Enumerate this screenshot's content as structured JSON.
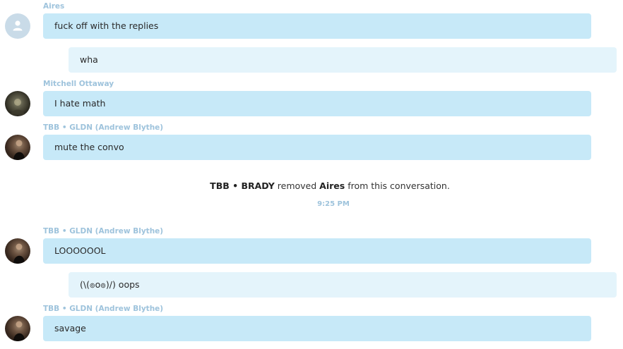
{
  "messages": {
    "m1": {
      "sender": "Aires",
      "text": "fuck off with the replies"
    },
    "m2": {
      "text": "wha"
    },
    "m3": {
      "sender": "Mitchell Ottaway",
      "text": "I hate math"
    },
    "m4": {
      "sender": "TBB • GLDN (Andrew Blythe)",
      "text": "mute the convo"
    },
    "m5": {
      "sender": "TBB • GLDN (Andrew Blythe)",
      "text": "LOOOOOOL"
    },
    "m6": {
      "text": "(\\(๏o๏)/) oops"
    },
    "m7": {
      "sender": "TBB • GLDN (Andrew Blythe)",
      "text": "savage"
    }
  },
  "system_event": {
    "actor": "TBB • BRADY",
    "action": "removed",
    "target": "Aires",
    "suffix": "from this conversation.",
    "time": "9:25 PM"
  },
  "colors": {
    "bubble": "#c7e9f8",
    "bubble_continuation": "#e4f4fb",
    "sender_name": "#9ec3dc"
  }
}
